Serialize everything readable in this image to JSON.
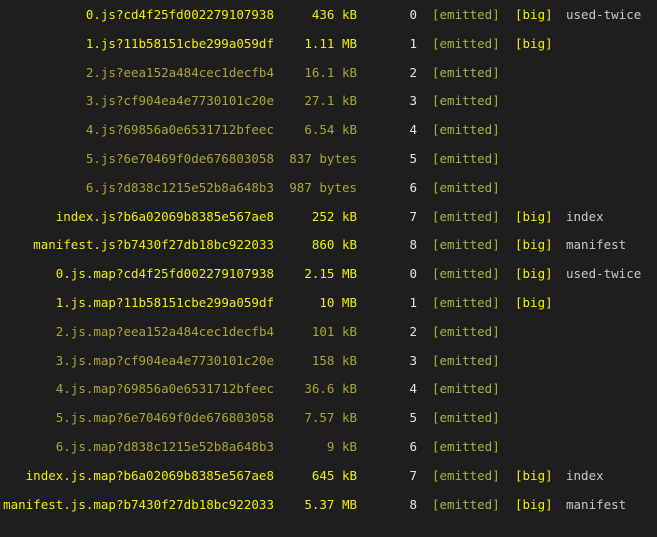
{
  "colors": {
    "background": "#1e1e1e",
    "bright_yellow": "#f0f000",
    "dim_yellow": "#a8a832",
    "status_green": "#a8b438",
    "chunk_white": "#e6e6e6",
    "name_gray": "#c8c8c8"
  },
  "rows": [
    {
      "asset": "0.js?cd4f25fd002279107938",
      "size": "436 kB",
      "chunk": "0",
      "emitted": "[emitted]",
      "big": "[big]",
      "name": "used-twice",
      "bright": true
    },
    {
      "asset": "1.js?11b58151cbe299a059df",
      "size": "1.11 MB",
      "chunk": "1",
      "emitted": "[emitted]",
      "big": "[big]",
      "name": "",
      "bright": true
    },
    {
      "asset": "2.js?eea152a484cec1decfb4",
      "size": "16.1 kB",
      "chunk": "2",
      "emitted": "[emitted]",
      "big": "",
      "name": "",
      "bright": false
    },
    {
      "asset": "3.js?cf904ea4e7730101c20e",
      "size": "27.1 kB",
      "chunk": "3",
      "emitted": "[emitted]",
      "big": "",
      "name": "",
      "bright": false
    },
    {
      "asset": "4.js?69856a0e6531712bfeec",
      "size": "6.54 kB",
      "chunk": "4",
      "emitted": "[emitted]",
      "big": "",
      "name": "",
      "bright": false
    },
    {
      "asset": "5.js?6e70469f0de676803058",
      "size": "837 bytes",
      "chunk": "5",
      "emitted": "[emitted]",
      "big": "",
      "name": "",
      "bright": false
    },
    {
      "asset": "6.js?d838c1215e52b8a648b3",
      "size": "987 bytes",
      "chunk": "6",
      "emitted": "[emitted]",
      "big": "",
      "name": "",
      "bright": false
    },
    {
      "asset": "index.js?b6a02069b8385e567ae8",
      "size": "252 kB",
      "chunk": "7",
      "emitted": "[emitted]",
      "big": "[big]",
      "name": "index",
      "bright": true
    },
    {
      "asset": "manifest.js?b7430f27db18bc922033",
      "size": "860 kB",
      "chunk": "8",
      "emitted": "[emitted]",
      "big": "[big]",
      "name": "manifest",
      "bright": true
    },
    {
      "asset": "0.js.map?cd4f25fd002279107938",
      "size": "2.15 MB",
      "chunk": "0",
      "emitted": "[emitted]",
      "big": "[big]",
      "name": "used-twice",
      "bright": true
    },
    {
      "asset": "1.js.map?11b58151cbe299a059df",
      "size": "10 MB",
      "chunk": "1",
      "emitted": "[emitted]",
      "big": "[big]",
      "name": "",
      "bright": true
    },
    {
      "asset": "2.js.map?eea152a484cec1decfb4",
      "size": "101 kB",
      "chunk": "2",
      "emitted": "[emitted]",
      "big": "",
      "name": "",
      "bright": false
    },
    {
      "asset": "3.js.map?cf904ea4e7730101c20e",
      "size": "158 kB",
      "chunk": "3",
      "emitted": "[emitted]",
      "big": "",
      "name": "",
      "bright": false
    },
    {
      "asset": "4.js.map?69856a0e6531712bfeec",
      "size": "36.6 kB",
      "chunk": "4",
      "emitted": "[emitted]",
      "big": "",
      "name": "",
      "bright": false
    },
    {
      "asset": "5.js.map?6e70469f0de676803058",
      "size": "7.57 kB",
      "chunk": "5",
      "emitted": "[emitted]",
      "big": "",
      "name": "",
      "bright": false
    },
    {
      "asset": "6.js.map?d838c1215e52b8a648b3",
      "size": "9 kB",
      "chunk": "6",
      "emitted": "[emitted]",
      "big": "",
      "name": "",
      "bright": false
    },
    {
      "asset": "index.js.map?b6a02069b8385e567ae8",
      "size": "645 kB",
      "chunk": "7",
      "emitted": "[emitted]",
      "big": "[big]",
      "name": "index",
      "bright": true
    },
    {
      "asset": "manifest.js.map?b7430f27db18bc922033",
      "size": "5.37 MB",
      "chunk": "8",
      "emitted": "[emitted]",
      "big": "[big]",
      "name": "manifest",
      "bright": true
    }
  ]
}
